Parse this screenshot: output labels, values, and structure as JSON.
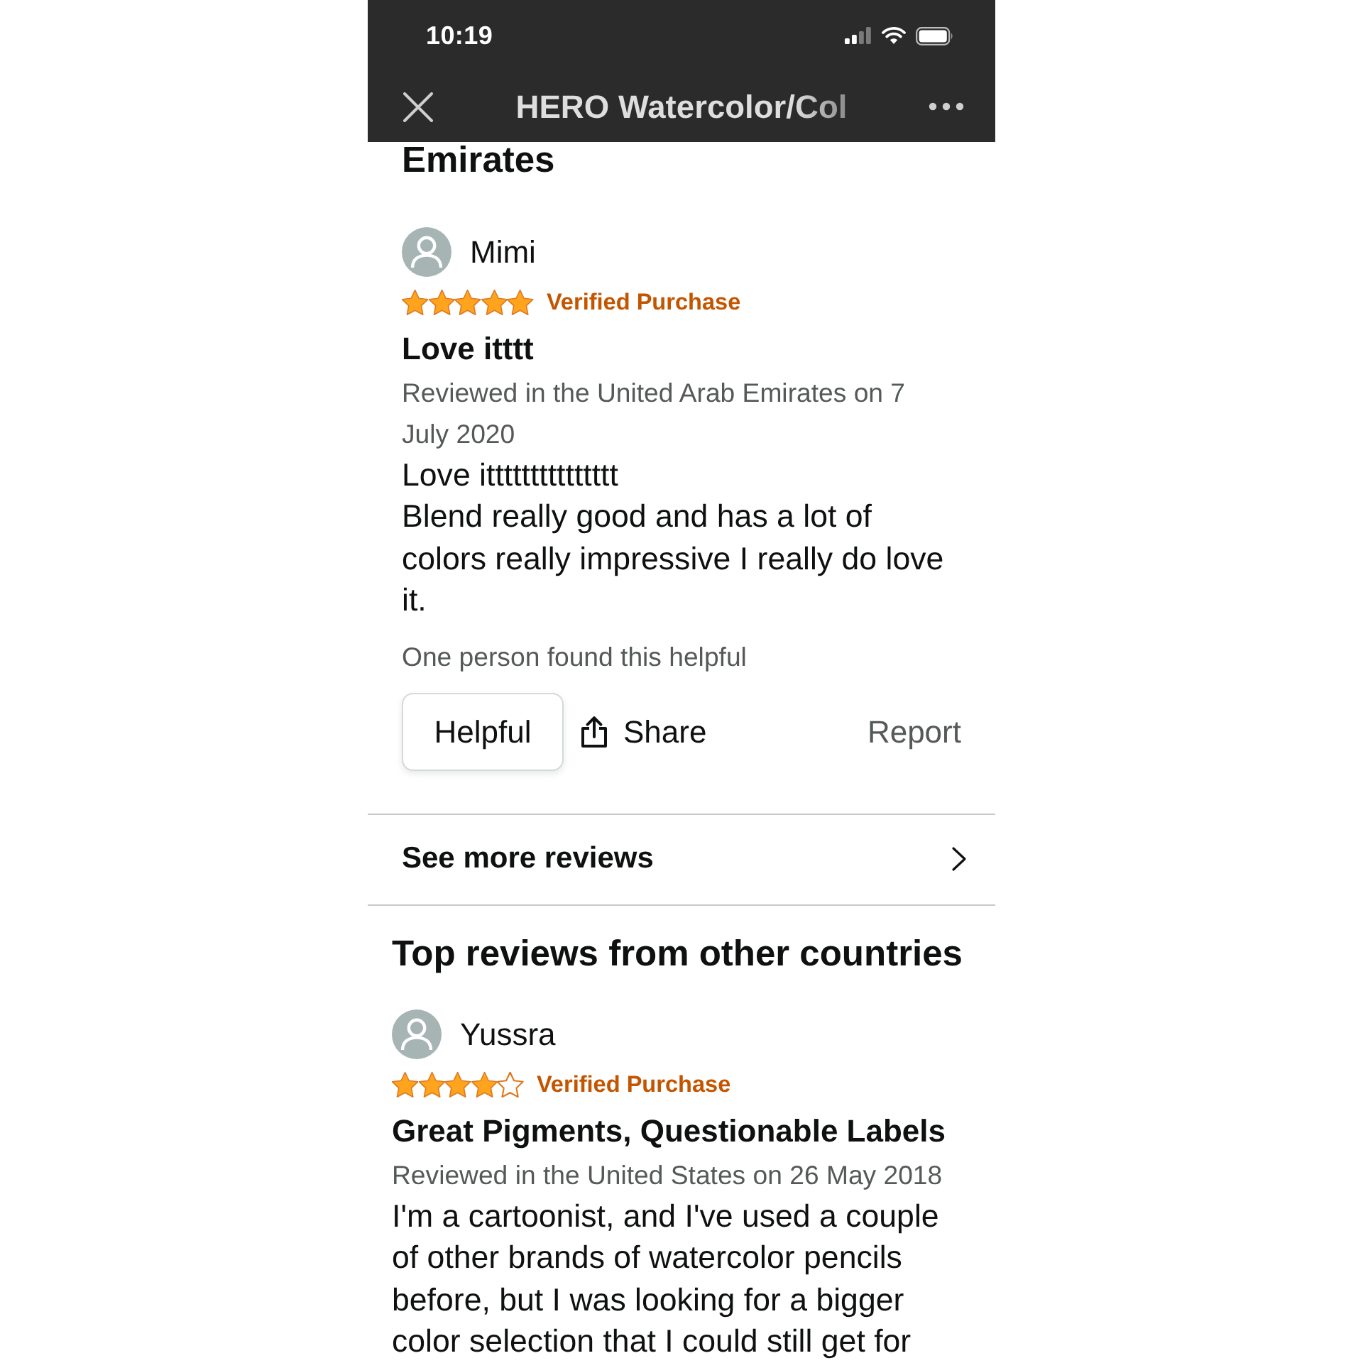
{
  "status_bar": {
    "time": "10:19"
  },
  "nav_bar": {
    "title": "HERO Watercolor/Col"
  },
  "local_reviews": {
    "heading": "Emirates",
    "reviews": [
      {
        "reviewer": "Mimi",
        "stars": 5,
        "badge": "Verified Purchase",
        "title": "Love itttt",
        "date": "Reviewed in the United Arab Emirates on 7 July 2020",
        "body": "Love ittttttttttttttt\nBlend really good and has a lot of colors really impressive I really do love it.",
        "helpful_count": "One person found this helpful",
        "actions": {
          "helpful": "Helpful",
          "share": "Share",
          "report": "Report"
        }
      }
    ]
  },
  "see_more": {
    "label": "See more reviews"
  },
  "other_countries": {
    "heading": "Top reviews from other countries",
    "reviews": [
      {
        "reviewer": "Yussra",
        "stars": 4,
        "badge": "Verified Purchase",
        "title": "Great Pigments, Questionable Labels",
        "date": "Reviewed in the United States on 26 May 2018",
        "body": "I'm a cartoonist, and I've used a couple of other brands of watercolor pencils before, but I was looking for a bigger color selection that I could still get for"
      }
    ]
  }
}
